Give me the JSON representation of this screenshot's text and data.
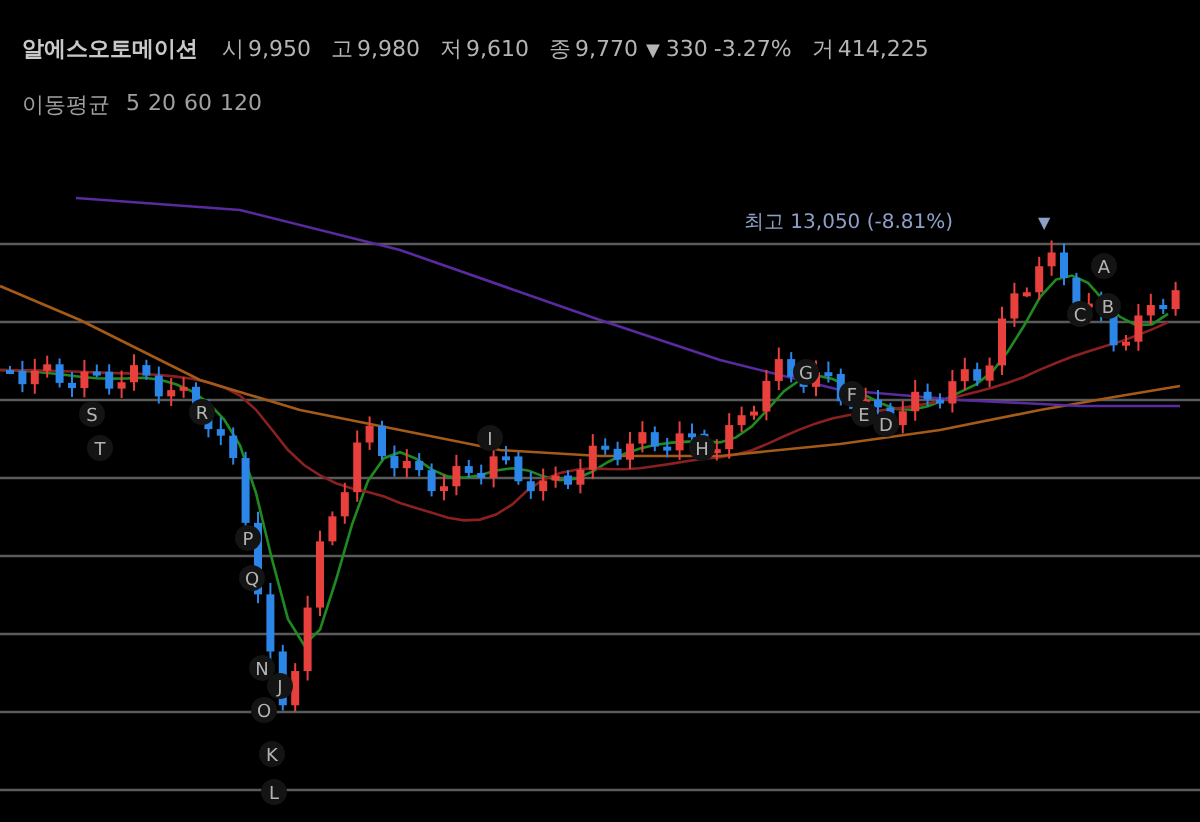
{
  "quote": {
    "name": "알에스오토메이션",
    "items": [
      {
        "label": "시",
        "value": "9,950"
      },
      {
        "label": "고",
        "value": "9,980"
      },
      {
        "label": "저",
        "value": "9,610"
      },
      {
        "label": "종",
        "value": "9,770"
      }
    ],
    "change": {
      "arrow": "▼",
      "amount": "330",
      "percent": "-3.27%"
    },
    "volume": {
      "label": "거",
      "value": "414,225"
    }
  },
  "moving_average": {
    "label": "이동평균",
    "periods": [
      "5",
      "20",
      "60",
      "120"
    ]
  },
  "chart": {
    "high_label": "최고 13,050 (-8.81%)",
    "high_arrow": "▼",
    "point_labels": [
      "S",
      "T",
      "R",
      "P",
      "Q",
      "N",
      "J",
      "O",
      "K",
      "L",
      "I",
      "H",
      "G",
      "F",
      "E",
      "D",
      "C",
      "A",
      "B"
    ]
  }
}
